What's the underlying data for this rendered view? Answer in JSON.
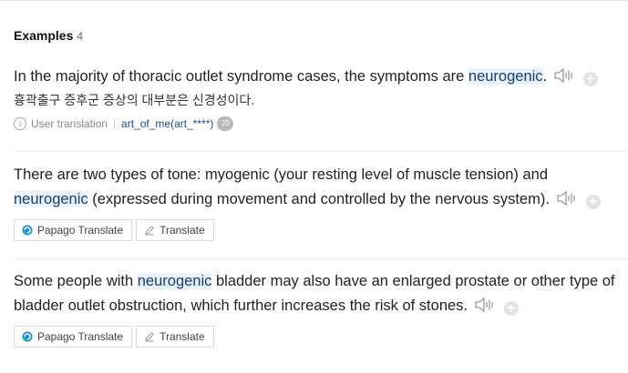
{
  "section": {
    "title": "Examples",
    "count": "4"
  },
  "examples": [
    {
      "parts": [
        "In the majority of thoracic outlet syndrome cases, the symptoms are ",
        "neurogenic",
        "."
      ],
      "translation": "흉곽출구 증후군 증상의 대부분은 신경성이다.",
      "source_label": "User translation",
      "user": "art_of_me(art_****)",
      "user_badge": "20"
    },
    {
      "parts": [
        "There are two types of tone: myogenic (your resting level of muscle tension) and ",
        "neurogenic",
        " (expressed during movement and controlled by the nervous system)."
      ],
      "papago_label": "Papago Translate",
      "translate_label": "Translate"
    },
    {
      "parts": [
        "Some people with ",
        "neurogenic",
        " bladder may also have an enlarged prostate or other type of bladder outlet obstruction, which further increases the risk of stones."
      ],
      "papago_label": "Papago Translate",
      "translate_label": "Translate"
    }
  ],
  "icons": {
    "speaker": "speaker-icon",
    "add": "plus-circle-icon",
    "info": "info-icon",
    "papago": "papago-logo-icon",
    "pencil": "pencil-icon"
  },
  "colors": {
    "highlight_bg": "#e7f2fd",
    "link": "#1e4c8c",
    "papago_green": "#22c55e",
    "papago_blue": "#1e88e5"
  }
}
